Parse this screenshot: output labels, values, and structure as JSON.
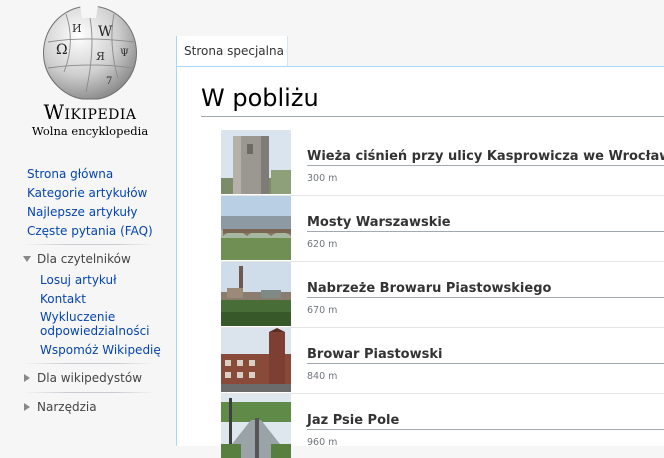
{
  "logo": {
    "wordmark": "Wikipedia",
    "tagline": "Wolna encyklopedia",
    "globe_glyphs": [
      "W",
      "Ω",
      "И",
      "Ψ",
      "Я",
      "7"
    ]
  },
  "nav": {
    "items": [
      {
        "label": "Strona główna"
      },
      {
        "label": "Kategorie artykułów"
      },
      {
        "label": "Najlepsze artykuły"
      },
      {
        "label": "Częste pytania (FAQ)"
      }
    ]
  },
  "portals": {
    "readers": {
      "heading": "Dla czytelników",
      "items": [
        {
          "label": "Losuj artykuł"
        },
        {
          "label": "Kontakt"
        },
        {
          "label": "Wykluczenie odpowiedzialności"
        },
        {
          "label": "Wspomóż Wikipedię"
        }
      ]
    },
    "editors": {
      "heading": "Dla wikipedystów"
    },
    "tools": {
      "heading": "Narzędzia"
    }
  },
  "tabs": {
    "special": "Strona specjalna"
  },
  "page": {
    "title": "W pobliżu"
  },
  "results": [
    {
      "title": "Wieża ciśnień przy ulicy Kasprowicza we Wrocławiu",
      "distance": "300 m"
    },
    {
      "title": "Mosty Warszawskie",
      "distance": "620 m"
    },
    {
      "title": "Nabrzeże Browaru Piastowskiego",
      "distance": "670 m"
    },
    {
      "title": "Browar Piastowski",
      "distance": "840 m"
    },
    {
      "title": "Jaz Psie Pole",
      "distance": "960 m"
    }
  ],
  "colors": {
    "link": "#0645ad",
    "border_blue": "#a7d7f9",
    "sidebar_bg": "#f6f6f6"
  }
}
